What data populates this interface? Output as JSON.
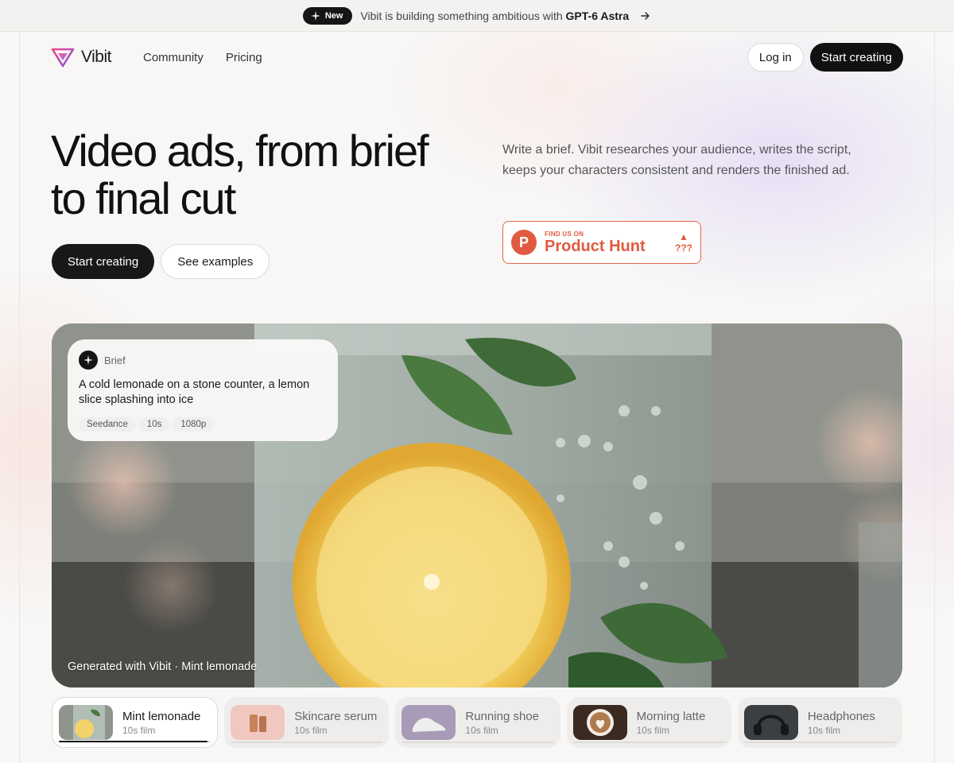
{
  "announcement": {
    "badge": "New",
    "text": "Vibit is building something ambitious with",
    "highlight": "GPT-6 Astra"
  },
  "nav": {
    "logo_text": "Vibit",
    "links": [
      "Community",
      "Pricing"
    ],
    "login": "Log in",
    "start": "Start creating"
  },
  "hero": {
    "title": "Video ads, from brief to final cut",
    "primary_cta": "Start creating",
    "secondary_cta": "See examples",
    "description": "Write a brief. Vibit researches your audience, writes the script, keeps your characters consistent and renders the finished ad."
  },
  "product_hunt": {
    "small": "FIND US ON",
    "big": "Product Hunt",
    "votes": "???",
    "color": "#e05a3f"
  },
  "video": {
    "brief_label": "Brief",
    "brief_text": "A cold lemonade on a stone counter, a lemon slice splashing into ice",
    "tags": [
      "Seedance",
      "10s",
      "1080p"
    ],
    "caption": "Generated with Vibit · Mint lemonade"
  },
  "thumbnails": [
    {
      "title": "Mint lemonade",
      "sub": "10s film",
      "active": true,
      "progress": 0.98
    },
    {
      "title": "Skincare serum",
      "sub": "10s film",
      "active": false,
      "progress": 0
    },
    {
      "title": "Running shoe",
      "sub": "10s film",
      "active": false,
      "progress": 0
    },
    {
      "title": "Morning latte",
      "sub": "10s film",
      "active": false,
      "progress": 0
    },
    {
      "title": "Headphones",
      "sub": "10s film",
      "active": false,
      "progress": 0
    }
  ]
}
